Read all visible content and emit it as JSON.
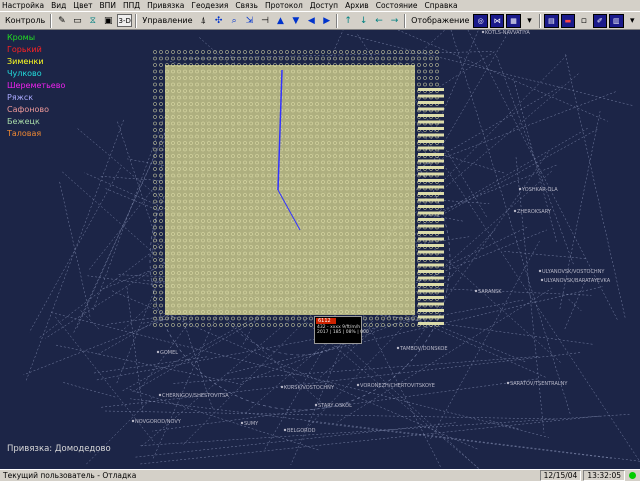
{
  "menu": [
    "Настройка",
    "Вид",
    "Цвет",
    "ВПИ",
    "ППД",
    "Привязка",
    "Геодезия",
    "Связь",
    "Протокол",
    "Доступ",
    "Архив",
    "Состояние",
    "Справка"
  ],
  "toolbar": {
    "control_label": "Контроль",
    "three_d_label": "3-D",
    "manage_label": "Управление",
    "display_label": "Отображение"
  },
  "legend": [
    {
      "label": "",
      "color": "#2222ff"
    },
    {
      "label": "Кромы",
      "color": "#22dd22"
    },
    {
      "label": "Горький",
      "color": "#ff2222"
    },
    {
      "label": "Зименки",
      "color": "#ffff22"
    },
    {
      "label": "Чулково",
      "color": "#22dddd"
    },
    {
      "label": "Шереметьево",
      "color": "#ee22ee"
    },
    {
      "label": "Ряжск",
      "color": "#aaaaff"
    },
    {
      "label": "Сафоново",
      "color": "#ee9999"
    },
    {
      "label": "Бежецк",
      "color": "#aaddaa"
    },
    {
      "label": "Таловая",
      "color": "#ee8833"
    }
  ],
  "anchor_text": "Привязка: Домодедово",
  "popup": {
    "title": "6112",
    "line1": "432 - xxxx 9/ft/m/h",
    "line2": "2017 | 185 | 08% | 000"
  },
  "cities": [
    "KOTLS-NAVVATIYA",
    "YOSHKAR-OLA",
    "ZHEROKSARY",
    "ULYANOVSK/VOSTOCHNY",
    "ULYANOVSK/BARATAYEVKA",
    "SARANSK",
    "TAMBOV/DONSKOE",
    "GOMEL",
    "CHERNIGOV/SHESTOVITSA",
    "KURSK/VOSTOCHNY",
    "VORONEZH/CHERTOVITSKOYE",
    "STARY OSKOL",
    "SUMY",
    "BELGOROD",
    "NOVGOROD/NOVY",
    "SARATOV/TSENTRALNY"
  ],
  "status": {
    "user": "Текущий пользователь - Отладка",
    "date": "12/15/04",
    "time": "13:32:05"
  }
}
